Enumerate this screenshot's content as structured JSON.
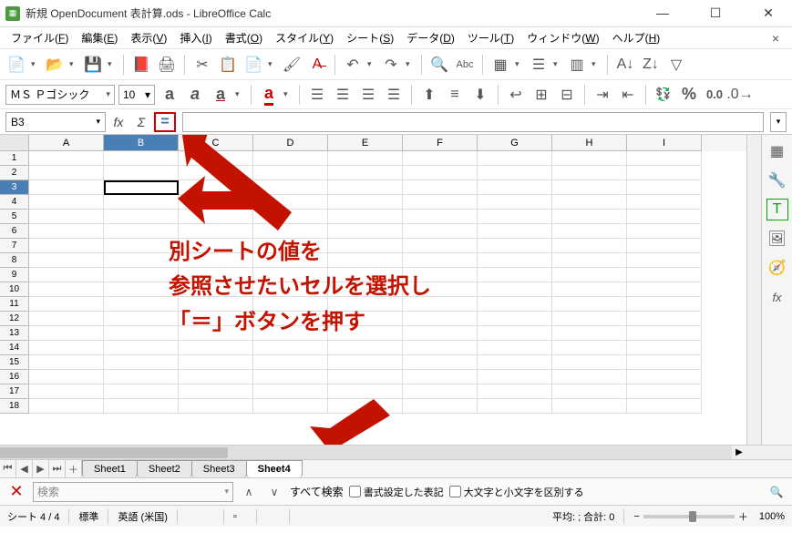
{
  "window": {
    "title": "新規 OpenDocument 表計算.ods - LibreOffice Calc"
  },
  "menu": {
    "items": [
      {
        "label": "ファイル",
        "key": "F"
      },
      {
        "label": "編集",
        "key": "E"
      },
      {
        "label": "表示",
        "key": "V"
      },
      {
        "label": "挿入",
        "key": "I"
      },
      {
        "label": "書式",
        "key": "O"
      },
      {
        "label": "スタイル",
        "key": "Y"
      },
      {
        "label": "シート",
        "key": "S"
      },
      {
        "label": "データ",
        "key": "D"
      },
      {
        "label": "ツール",
        "key": "T"
      },
      {
        "label": "ウィンドウ",
        "key": "W"
      },
      {
        "label": "ヘルプ",
        "key": "H"
      }
    ]
  },
  "font": {
    "name": "ＭＳ Ｐゴシック",
    "size": "10"
  },
  "formula": {
    "cell_ref": "B3",
    "equals": "=",
    "fx": "fx",
    "sigma": "Σ"
  },
  "columns": [
    "A",
    "B",
    "C",
    "D",
    "E",
    "F",
    "G",
    "H",
    "I"
  ],
  "rows": [
    "1",
    "2",
    "3",
    "4",
    "5",
    "6",
    "7",
    "8",
    "9",
    "10",
    "11",
    "12",
    "13",
    "14",
    "15",
    "16",
    "17",
    "18"
  ],
  "active_col": "B",
  "active_row": "3",
  "annotation": {
    "line1": "別シートの値を",
    "line2": "参照させたいセルを選択し",
    "line3": "「＝」ボタンを押す"
  },
  "tabs": {
    "nav": {
      "first": "⏮",
      "prev": "◀",
      "next": "▶",
      "last": "⏭",
      "add": "＋"
    },
    "items": [
      "Sheet1",
      "Sheet2",
      "Sheet3",
      "Sheet4"
    ],
    "active": "Sheet4"
  },
  "find": {
    "placeholder": "検索",
    "all": "すべて検索",
    "fmt": "書式設定した表記",
    "case": "大文字と小文字を区別する"
  },
  "status": {
    "sheet": "シート 4 / 4",
    "style": "標準",
    "lang": "英語 (米国)",
    "calc": "平均: ; 合計: 0",
    "zoom": "100%",
    "minus": "−",
    "plus": "＋"
  },
  "icons": {
    "new": "📄",
    "open": "📂",
    "save": "💾",
    "pdf": "📕",
    "print": "🖨",
    "cut": "✂",
    "copy": "📋",
    "paste": "📄",
    "brush": "🖌",
    "undo": "↶",
    "redo": "↷",
    "search": "🔍",
    "spell": "Abc",
    "table": "▦",
    "sort": "↕",
    "filter": "▽",
    "image": "🖼",
    "chart": "📊",
    "link": "🔗",
    "bold_a": "a",
    "align_l": "≡",
    "align_c": "≡",
    "align_r": "≡",
    "align_j": "≡",
    "merge": "⊞",
    "indent": "⇥",
    "outdent": "⇤",
    "currency": "¥",
    "percent": "%",
    "num": "0.0",
    "dec_add": "➕",
    "dec_rem": "➖",
    "wrench": "🔧",
    "t_icon": "T",
    "clip": "📋",
    "gallery": "🖼",
    "fx_side": "fx",
    "close_find": "✕",
    "nav_up": "∧",
    "nav_dn": "∨",
    "tool": "🔧"
  }
}
